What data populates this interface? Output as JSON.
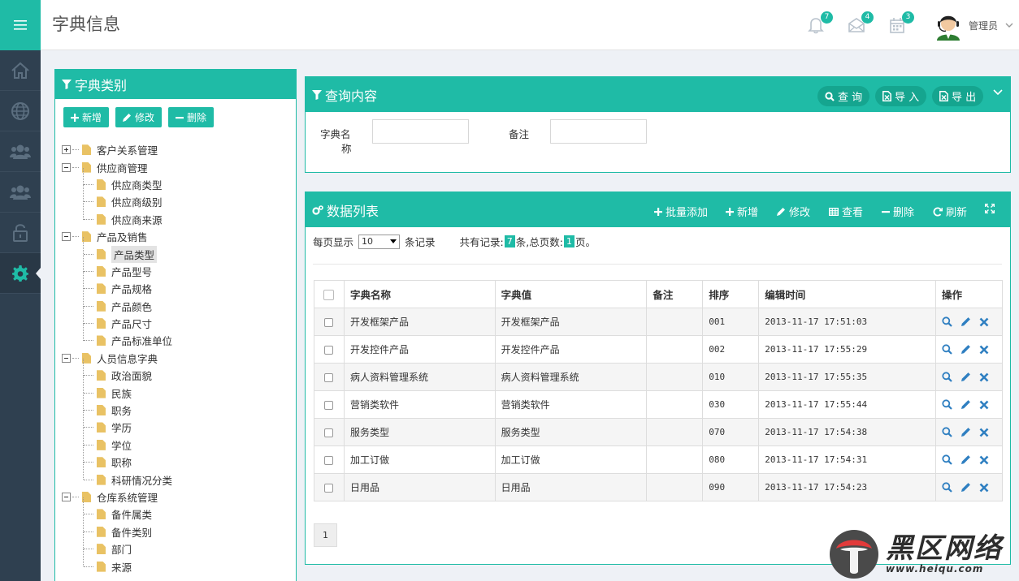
{
  "header": {
    "title": "字典信息",
    "notifications_count": "7",
    "messages_count": "4",
    "tasks_count": "3",
    "user_name": "管理员"
  },
  "tree_panel": {
    "title": "字典类别",
    "buttons": {
      "add": "新增",
      "edit": "修改",
      "delete": "删除"
    },
    "nodes": [
      {
        "label": "客户关系管理",
        "level": 0,
        "collapsed": true
      },
      {
        "label": "供应商管理",
        "level": 0,
        "collapsed": false
      },
      {
        "label": "供应商类型",
        "level": 1
      },
      {
        "label": "供应商级别",
        "level": 1
      },
      {
        "label": "供应商来源",
        "level": 1
      },
      {
        "label": "产品及销售",
        "level": 0,
        "collapsed": false
      },
      {
        "label": "产品类型",
        "level": 1,
        "selected": true
      },
      {
        "label": "产品型号",
        "level": 1
      },
      {
        "label": "产品规格",
        "level": 1
      },
      {
        "label": "产品颜色",
        "level": 1
      },
      {
        "label": "产品尺寸",
        "level": 1
      },
      {
        "label": "产品标准单位",
        "level": 1
      },
      {
        "label": "人员信息字典",
        "level": 0,
        "collapsed": false
      },
      {
        "label": "政治面貌",
        "level": 1
      },
      {
        "label": "民族",
        "level": 1
      },
      {
        "label": "职务",
        "level": 1
      },
      {
        "label": "学历",
        "level": 1
      },
      {
        "label": "学位",
        "level": 1
      },
      {
        "label": "职称",
        "level": 1
      },
      {
        "label": "科研情况分类",
        "level": 1
      },
      {
        "label": "仓库系统管理",
        "level": 0,
        "collapsed": false
      },
      {
        "label": "备件属类",
        "level": 1
      },
      {
        "label": "备件类别",
        "level": 1
      },
      {
        "label": "部门",
        "level": 1
      },
      {
        "label": "来源",
        "level": 1
      }
    ]
  },
  "query_panel": {
    "title": "查询内容",
    "buttons": {
      "search": "查 询",
      "import": "导 入",
      "export": "导 出"
    },
    "name_label_1": "字典名",
    "name_label_2": "称",
    "name_value": "",
    "note_label": "备注",
    "note_value": ""
  },
  "data_panel": {
    "title": "数据列表",
    "toolbar": {
      "batch_add": "批量添加",
      "add": "新增",
      "edit": "修改",
      "view": "查看",
      "delete": "删除",
      "refresh": "刷新"
    },
    "per_page_label": "每页显示",
    "per_page_value": "10",
    "records_suffix": "条记录",
    "total_label": "共有记录:",
    "total_records": "7",
    "total_mid": "条,总页数:",
    "total_pages": "1",
    "total_suffix": "页。",
    "columns": [
      "字典名称",
      "字典值",
      "备注",
      "排序",
      "编辑时间",
      "操作"
    ],
    "rows": [
      {
        "name": "开发框架产品",
        "value": "开发框架产品",
        "note": "",
        "order": "001",
        "time": "2013-11-17 17:51:03"
      },
      {
        "name": "开发控件产品",
        "value": "开发控件产品",
        "note": "",
        "order": "002",
        "time": "2013-11-17 17:55:29"
      },
      {
        "name": "病人资料管理系统",
        "value": "病人资料管理系统",
        "note": "",
        "order": "010",
        "time": "2013-11-17 17:55:35"
      },
      {
        "name": "营销类软件",
        "value": "营销类软件",
        "note": "",
        "order": "030",
        "time": "2013-11-17 17:55:44"
      },
      {
        "name": "服务类型",
        "value": "服务类型",
        "note": "",
        "order": "070",
        "time": "2013-11-17 17:54:38"
      },
      {
        "name": "加工订做",
        "value": "加工订做",
        "note": "",
        "order": "080",
        "time": "2013-11-17 17:54:31"
      },
      {
        "name": "日用品",
        "value": "日用品",
        "note": "",
        "order": "090",
        "time": "2013-11-17 17:54:23"
      }
    ],
    "current_page": "1"
  },
  "watermark": {
    "cn": "黑区网络",
    "url": "www.heiqu.com"
  },
  "colors": {
    "accent": "#1fbba6",
    "sidebar": "#2f4050",
    "icon_blue": "#2f7fc1"
  }
}
